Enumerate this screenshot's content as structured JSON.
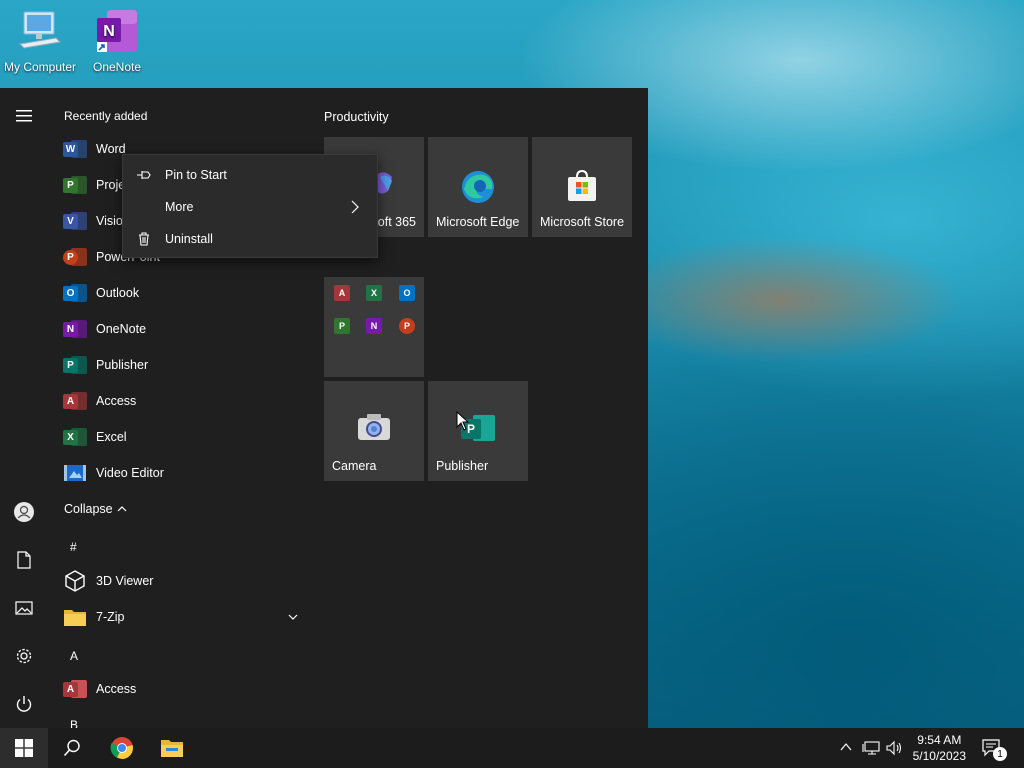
{
  "desktop": {
    "icons": [
      {
        "label": "My Computer"
      },
      {
        "label": "OneNote"
      }
    ]
  },
  "start_menu": {
    "rail": [
      "menu-icon",
      "user-icon",
      "documents-icon",
      "pictures-icon",
      "settings-icon",
      "power-icon"
    ],
    "recently_added_header": "Recently added",
    "recent_apps": [
      {
        "label": "Word",
        "color": "#2b579a",
        "letter": "W"
      },
      {
        "label": "Project",
        "color": "#31752f",
        "letter": "P"
      },
      {
        "label": "Visio",
        "color": "#3955a3",
        "letter": "V"
      },
      {
        "label": "PowerPoint",
        "color": "#c43e1c",
        "letter": "P"
      },
      {
        "label": "Outlook",
        "color": "#0072c6",
        "letter": "O"
      },
      {
        "label": "OneNote",
        "color": "#7719aa",
        "letter": "N"
      },
      {
        "label": "Publisher",
        "color": "#077568",
        "letter": "P"
      },
      {
        "label": "Access",
        "color": "#a4373a",
        "letter": "A"
      },
      {
        "label": "Excel",
        "color": "#217346",
        "letter": "X"
      },
      {
        "label": "Video Editor",
        "color": "#1b6ac9",
        "letter": ""
      }
    ],
    "collapse_label": "Collapse",
    "section_hash": "#",
    "section_a": "A",
    "section_b": "B",
    "all_apps": [
      {
        "label": "3D Viewer"
      },
      {
        "label": "7-Zip"
      },
      {
        "label": "Access"
      }
    ],
    "tiles": {
      "group_title": "Productivity",
      "items": [
        {
          "label": "Microsoft 365..."
        },
        {
          "label": "Microsoft Edge"
        },
        {
          "label": "Microsoft Store"
        },
        {
          "label": "Camera"
        },
        {
          "label": "Publisher"
        }
      ],
      "office_folder_letters": [
        "A",
        "X",
        "O",
        "P",
        "N",
        "P"
      ]
    }
  },
  "context_menu": {
    "items": [
      {
        "label": "Pin to Start",
        "icon": "pin-icon"
      },
      {
        "label": "More",
        "icon": "chevron-right-icon"
      },
      {
        "label": "Uninstall",
        "icon": "trash-icon"
      }
    ]
  },
  "taskbar": {
    "time": "9:54 AM",
    "date": "5/10/2023",
    "notification_count": "1"
  },
  "colors": {
    "start_bg": "#1f1f1f",
    "tile_bg": "#3a3a3a",
    "taskbar_bg": "#1c1c1c",
    "context_bg": "#2b2b2b"
  }
}
